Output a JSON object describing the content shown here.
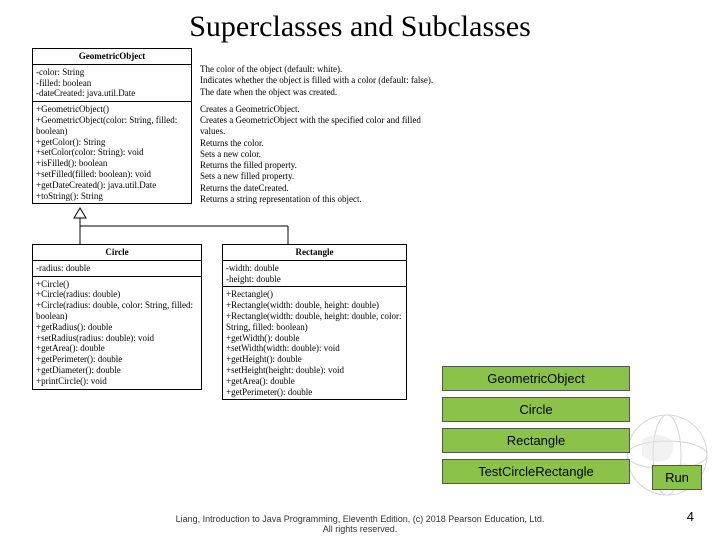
{
  "title": "Superclasses and Subclasses",
  "geo": {
    "name": "GeometricObject",
    "attrs": [
      "-color: String",
      "-filled: boolean",
      "-dateCreated: java.util.Date"
    ],
    "ops": [
      "+GeometricObject()",
      "+GeometricObject(color: String, filled: boolean)",
      "+getColor(): String",
      "+setColor(color: String): void",
      "+isFilled(): boolean",
      "+setFilled(filled: boolean): void",
      "+getDateCreated(): java.util.Date",
      "+toString(): String"
    ],
    "notesA": [
      "The color of the object (default: white).",
      "Indicates whether the object is filled with a color (default: false).",
      "The date when the object was created."
    ],
    "notesB": [
      "Creates a GeometricObject.",
      "Creates a GeometricObject with the specified color and filled values.",
      "Returns the color.",
      "Sets a new color.",
      "Returns the filled property.",
      "Sets a new filled property.",
      "Returns the dateCreated.",
      "Returns a string representation of this object."
    ]
  },
  "circle": {
    "name": "Circle",
    "attrs": [
      "-radius: double"
    ],
    "ops": [
      "+Circle()",
      "+Circle(radius: double)",
      "+Circle(radius: double, color: String, filled: boolean)",
      "+getRadius(): double",
      "+setRadius(radius: double): void",
      "+getArea(): double",
      "+getPerimeter(): double",
      "+getDiameter(): double",
      "+printCircle(): void"
    ]
  },
  "rect": {
    "name": "Rectangle",
    "attrs": [
      "-width: double",
      "-height: double"
    ],
    "ops": [
      "+Rectangle()",
      "+Rectangle(width: double, height: double)",
      "+Rectangle(width: double, height: double, color: String, filled: boolean)",
      "+getWidth(): double",
      "+setWidth(width: double): void",
      "+getHeight(): double",
      "+setHeight(height: double): void",
      "+getArea(): double",
      "+getPerimeter(): double"
    ]
  },
  "buttons": {
    "b1": "GeometricObject",
    "b2": "Circle",
    "b3": "Rectangle",
    "b4": "TestCircleRectangle",
    "run": "Run"
  },
  "footer": {
    "line1": "Liang, Introduction to Java Programming, Eleventh Edition, (c) 2018 Pearson Education, Ltd.",
    "line2": "All rights reserved.",
    "page": "4"
  }
}
